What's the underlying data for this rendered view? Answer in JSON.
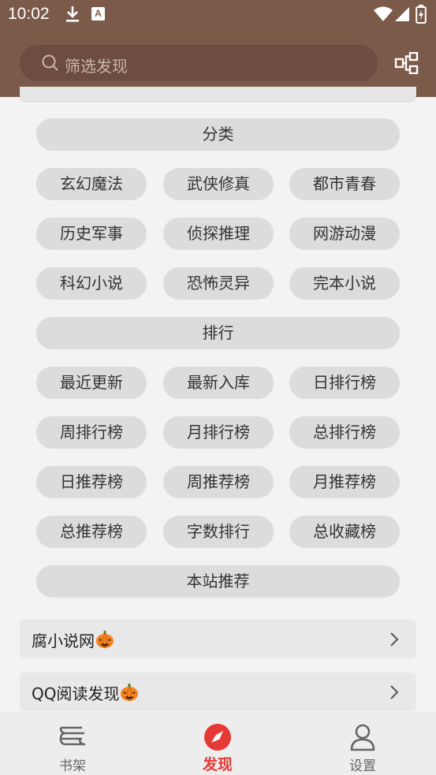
{
  "status": {
    "time": "10:02",
    "badge": "A"
  },
  "search": {
    "placeholder": "筛选发现"
  },
  "sections": [
    {
      "header": "分类",
      "tags": [
        "玄幻魔法",
        "武侠修真",
        "都市青春",
        "历史军事",
        "侦探推理",
        "网游动漫",
        "科幻小说",
        "恐怖灵异",
        "完本小说"
      ]
    },
    {
      "header": "排行",
      "tags": [
        "最近更新",
        "最新入库",
        "日排行榜",
        "周排行榜",
        "月排行榜",
        "总排行榜",
        "日推荐榜",
        "周推荐榜",
        "月推荐榜",
        "总推荐榜",
        "字数排行",
        "总收藏榜"
      ]
    },
    {
      "header": "本站推荐",
      "tags": []
    }
  ],
  "sources": [
    {
      "name": "腐小说网"
    },
    {
      "name": "QQ阅读发现"
    }
  ],
  "nav": [
    {
      "label": "书架",
      "icon": "bookshelf-icon"
    },
    {
      "label": "发现",
      "icon": "compass-icon"
    },
    {
      "label": "设置",
      "icon": "person-icon"
    }
  ],
  "colors": {
    "appbar": "#7b5a4a",
    "accent": "#e53935"
  }
}
